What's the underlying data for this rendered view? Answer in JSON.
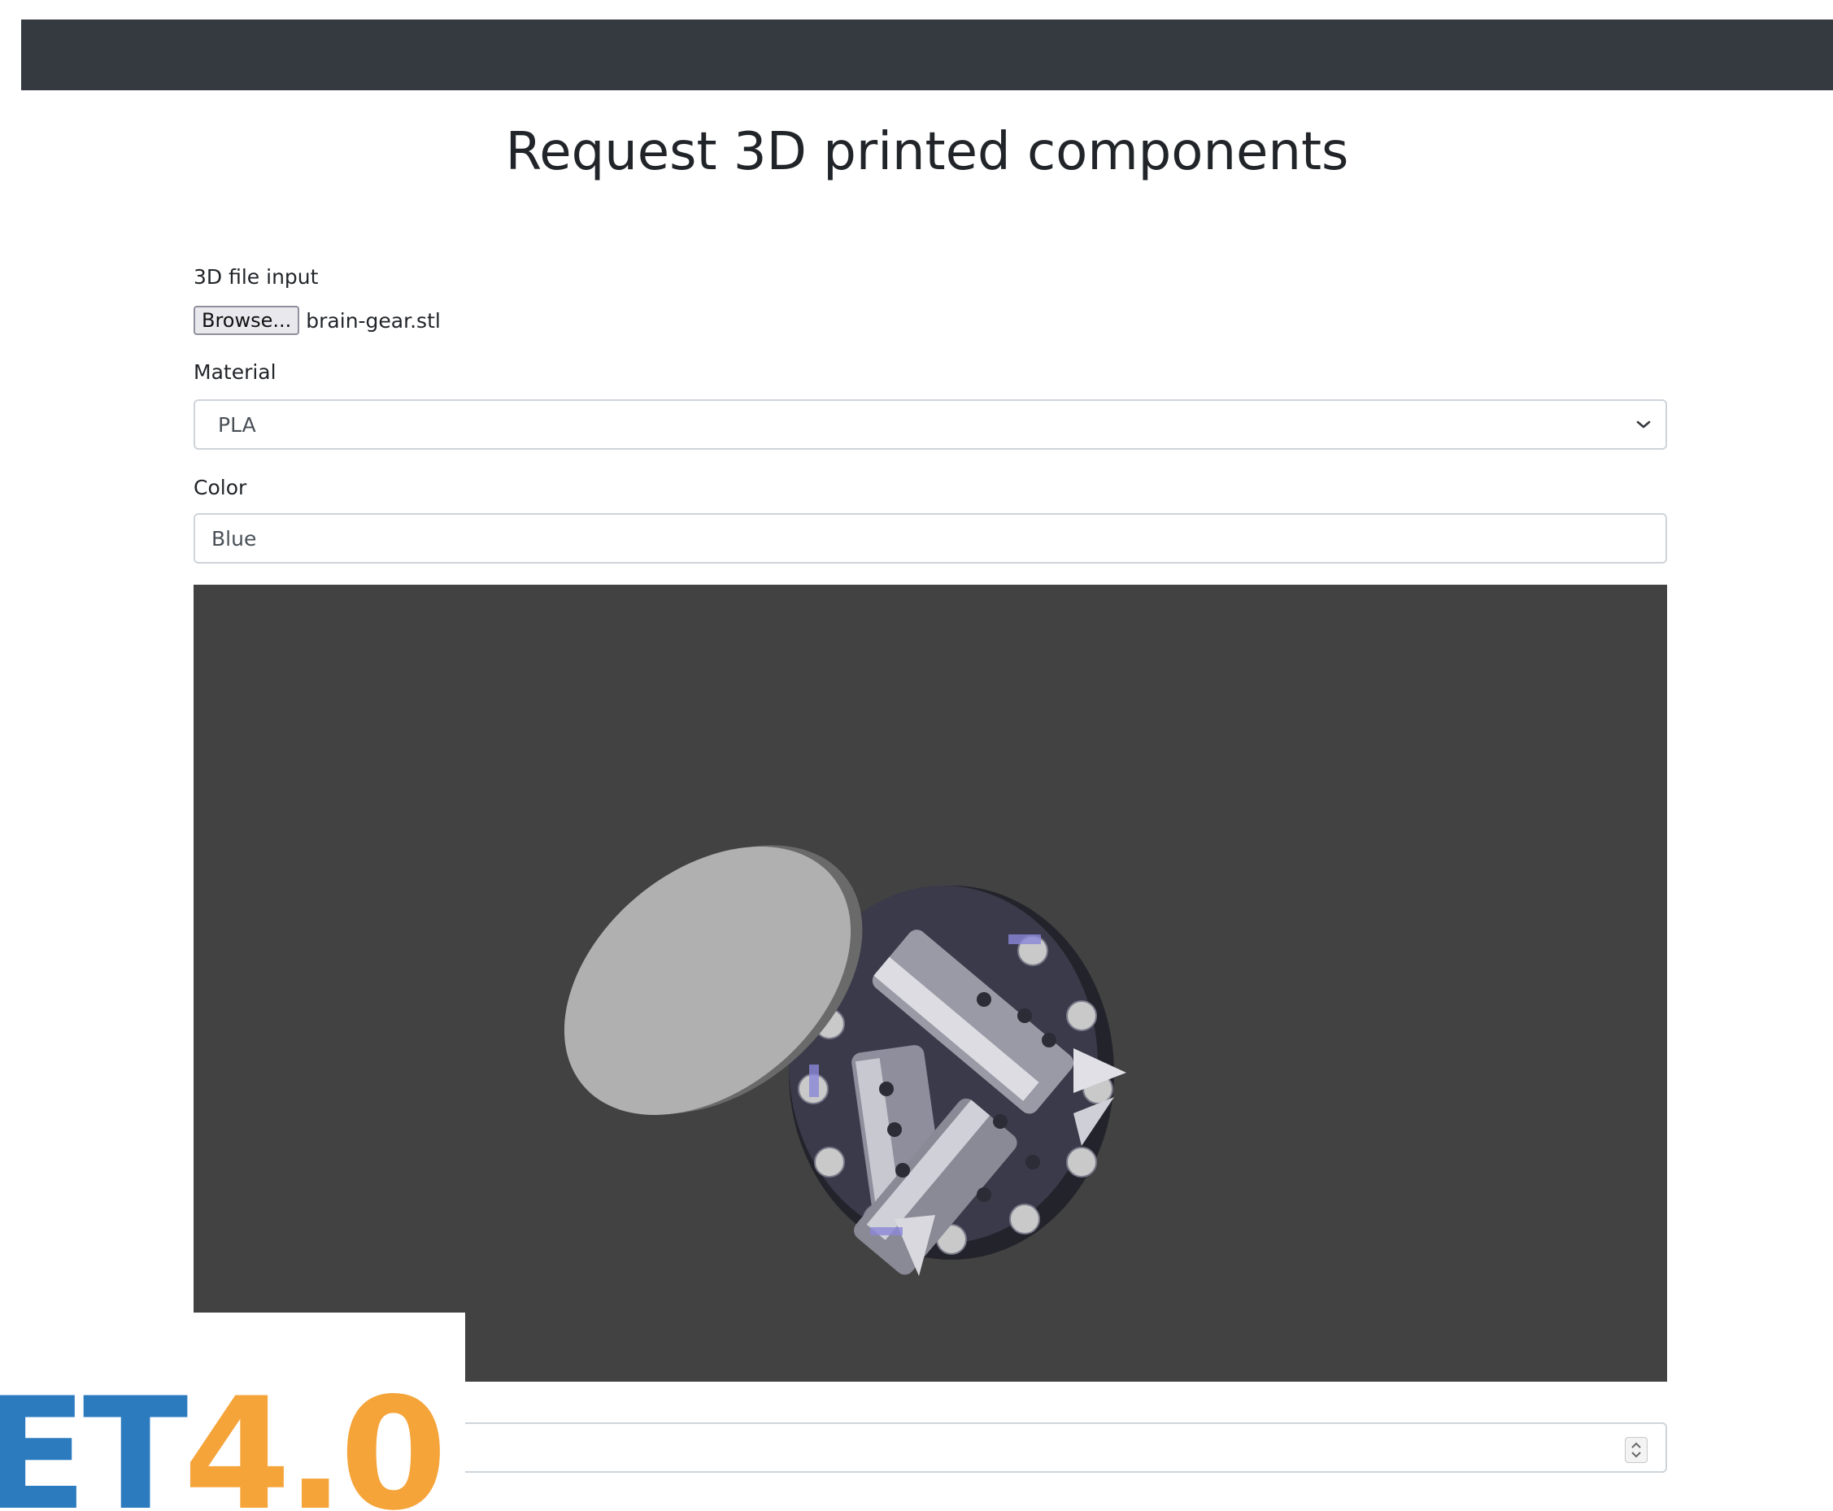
{
  "page": {
    "title": "Request 3D printed components"
  },
  "form": {
    "file_label": "3D file input",
    "browse_label": "Browse...",
    "file_name": "brain-gear.stl",
    "material_label": "Material",
    "material_value": "PLA",
    "color_label": "Color",
    "color_value": "Blue"
  },
  "viewer": {
    "icon": "3d-model-preview",
    "background_color": "#424242"
  },
  "logo": {
    "part1": "ET",
    "part2": "4.0",
    "color1": "#2c7bbf",
    "color2": "#f5a43a"
  },
  "colors": {
    "navbar": "#343a40"
  }
}
